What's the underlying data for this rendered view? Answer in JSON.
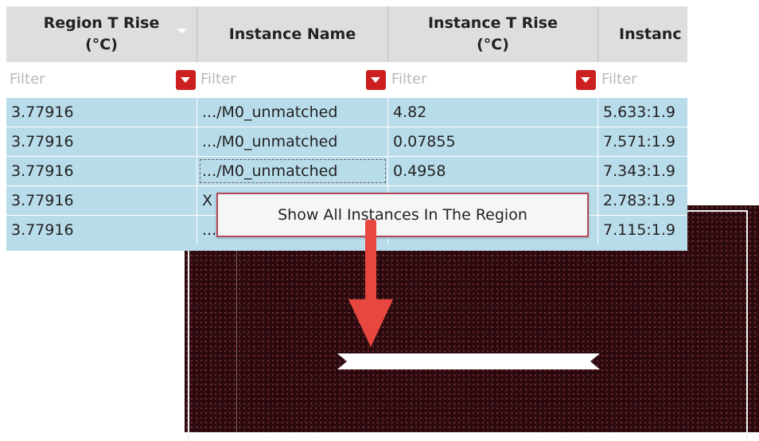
{
  "table": {
    "columns": [
      {
        "label": "Region T Rise\n(°C)",
        "sortable": true
      },
      {
        "label": "Instance Name",
        "sortable": false
      },
      {
        "label": "Instance T Rise\n(°C)",
        "sortable": false
      },
      {
        "label": "Instanc",
        "sortable": false
      }
    ],
    "filter_placeholder": "Filter",
    "rows": [
      [
        "3.77916",
        ".../M0_unmatched",
        "4.82",
        "5.633:1.9"
      ],
      [
        "3.77916",
        ".../M0_unmatched",
        "0.07855",
        "7.571:1.9"
      ],
      [
        "3.77916",
        ".../M0_unmatched",
        "0.4958",
        "7.343:1.9"
      ],
      [
        "3.77916",
        "X",
        "",
        "2.783:1.9"
      ],
      [
        "3.77916",
        "...",
        "",
        "7.115:1.9"
      ]
    ]
  },
  "context_menu": {
    "items": [
      {
        "label": "Show All Instances In The Region"
      }
    ]
  },
  "colors": {
    "selection": "#b9dcea",
    "header": "#dedede",
    "filter_button": "#cc1f1f",
    "layout_bg": "#2a0a0e",
    "arrow": "#e8473f"
  }
}
